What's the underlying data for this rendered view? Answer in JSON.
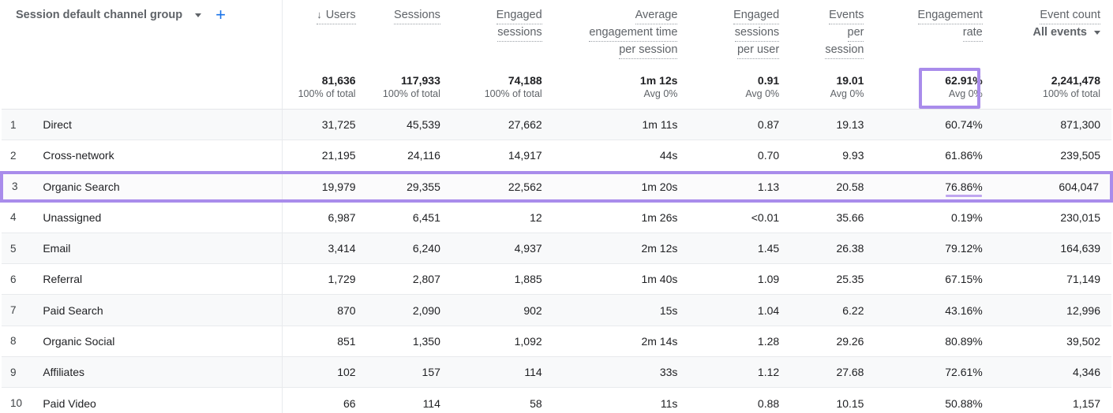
{
  "header": {
    "dimension_label": "Session default channel group",
    "dimension_caret_icon": "chevron-down-icon",
    "add_dimension_icon": "plus-icon",
    "sort_icon": "arrow-down-icon",
    "accent_purple": "#a98ceb",
    "accent_blue": "#1a73e8",
    "columns": [
      {
        "id": "users",
        "label": "Users",
        "label2": "",
        "sorted": true
      },
      {
        "id": "sessions",
        "label": "Sessions",
        "label2": "",
        "sorted": false
      },
      {
        "id": "engaged_sessions",
        "label": "Engaged",
        "label2": "sessions",
        "sorted": false
      },
      {
        "id": "avg_engagement_time",
        "label": "Average",
        "label2": "engagement time",
        "label3": "per session",
        "sorted": false
      },
      {
        "id": "engaged_sessions_per_user",
        "label": "Engaged",
        "label2": "sessions",
        "label3": "per user",
        "sorted": false
      },
      {
        "id": "events_per_session",
        "label": "Events",
        "label2": "per",
        "label3": "session",
        "sorted": false
      },
      {
        "id": "engagement_rate",
        "label": "Engagement",
        "label2": "rate",
        "sorted": false
      },
      {
        "id": "event_count",
        "label": "Event count",
        "label2": "",
        "dropdown": "All events",
        "dropdown_caret_icon": "chevron-down-icon",
        "sorted": false
      }
    ]
  },
  "totals": {
    "users": {
      "value": "81,636",
      "sub": "100% of total"
    },
    "sessions": {
      "value": "117,933",
      "sub": "100% of total"
    },
    "engaged_sessions": {
      "value": "74,188",
      "sub": "100% of total"
    },
    "avg_engagement_time": {
      "value": "1m 12s",
      "sub": "Avg 0%"
    },
    "engaged_sessions_per_user": {
      "value": "0.91",
      "sub": "Avg 0%"
    },
    "events_per_session": {
      "value": "19.01",
      "sub": "Avg 0%"
    },
    "engagement_rate": {
      "value": "62.91%",
      "sub": "Avg 0%",
      "highlighted": true
    },
    "event_count": {
      "value": "2,241,478",
      "sub": "100% of total"
    }
  },
  "rows": [
    {
      "rank": "1",
      "channel": "Direct",
      "users": "31,725",
      "sessions": "45,539",
      "engaged_sessions": "27,662",
      "avg_engagement_time": "1m 11s",
      "engaged_sessions_per_user": "0.87",
      "events_per_session": "19.13",
      "engagement_rate": "60.74%",
      "event_count": "871,300"
    },
    {
      "rank": "2",
      "channel": "Cross-network",
      "users": "21,195",
      "sessions": "24,116",
      "engaged_sessions": "14,917",
      "avg_engagement_time": "44s",
      "engaged_sessions_per_user": "0.70",
      "events_per_session": "9.93",
      "engagement_rate": "61.86%",
      "event_count": "239,505"
    },
    {
      "rank": "3",
      "channel": "Organic Search",
      "users": "19,979",
      "sessions": "29,355",
      "engaged_sessions": "22,562",
      "avg_engagement_time": "1m 20s",
      "engaged_sessions_per_user": "1.13",
      "events_per_session": "20.58",
      "engagement_rate": "76.86%",
      "event_count": "604,047"
    },
    {
      "rank": "4",
      "channel": "Unassigned",
      "users": "6,987",
      "sessions": "6,451",
      "engaged_sessions": "12",
      "avg_engagement_time": "1m 26s",
      "engaged_sessions_per_user": "<0.01",
      "events_per_session": "35.66",
      "engagement_rate": "0.19%",
      "event_count": "230,015"
    },
    {
      "rank": "5",
      "channel": "Email",
      "users": "3,414",
      "sessions": "6,240",
      "engaged_sessions": "4,937",
      "avg_engagement_time": "2m 12s",
      "engaged_sessions_per_user": "1.45",
      "events_per_session": "26.38",
      "engagement_rate": "79.12%",
      "event_count": "164,639"
    },
    {
      "rank": "6",
      "channel": "Referral",
      "users": "1,729",
      "sessions": "2,807",
      "engaged_sessions": "1,885",
      "avg_engagement_time": "1m 40s",
      "engaged_sessions_per_user": "1.09",
      "events_per_session": "25.35",
      "engagement_rate": "67.15%",
      "event_count": "71,149"
    },
    {
      "rank": "7",
      "channel": "Paid Search",
      "users": "870",
      "sessions": "2,090",
      "engaged_sessions": "902",
      "avg_engagement_time": "15s",
      "engaged_sessions_per_user": "1.04",
      "events_per_session": "6.22",
      "engagement_rate": "43.16%",
      "event_count": "12,996"
    },
    {
      "rank": "8",
      "channel": "Organic Social",
      "users": "851",
      "sessions": "1,350",
      "engaged_sessions": "1,092",
      "avg_engagement_time": "2m 14s",
      "engaged_sessions_per_user": "1.28",
      "events_per_session": "29.26",
      "engagement_rate": "80.89%",
      "event_count": "39,502"
    },
    {
      "rank": "9",
      "channel": "Affiliates",
      "users": "102",
      "sessions": "157",
      "engaged_sessions": "114",
      "avg_engagement_time": "33s",
      "engaged_sessions_per_user": "1.12",
      "events_per_session": "27.68",
      "engagement_rate": "72.61%",
      "event_count": "4,346"
    },
    {
      "rank": "10",
      "channel": "Paid Video",
      "users": "66",
      "sessions": "114",
      "engaged_sessions": "58",
      "avg_engagement_time": "11s",
      "engaged_sessions_per_user": "0.88",
      "events_per_session": "10.15",
      "engagement_rate": "50.88%",
      "event_count": "1,157"
    }
  ],
  "chart_data": {
    "type": "table",
    "title": "",
    "dimension": "Session default channel group",
    "columns": [
      "Users",
      "Sessions",
      "Engaged sessions",
      "Average engagement time per session",
      "Engaged sessions per user",
      "Events per session",
      "Engagement rate",
      "Event count"
    ],
    "categories": [
      "Direct",
      "Cross-network",
      "Organic Search",
      "Unassigned",
      "Email",
      "Referral",
      "Paid Search",
      "Organic Social",
      "Affiliates",
      "Paid Video"
    ],
    "series": [
      {
        "name": "Users",
        "values": [
          31725,
          21195,
          19979,
          6987,
          3414,
          1729,
          870,
          851,
          102,
          66
        ],
        "total": 81636
      },
      {
        "name": "Sessions",
        "values": [
          45539,
          24116,
          29355,
          6451,
          6240,
          2807,
          2090,
          1350,
          157,
          114
        ],
        "total": 117933
      },
      {
        "name": "Engaged sessions",
        "values": [
          27662,
          14917,
          22562,
          12,
          4937,
          1885,
          902,
          1092,
          114,
          58
        ],
        "total": 74188
      },
      {
        "name": "Average engagement time per session (s)",
        "values": [
          71,
          44,
          80,
          86,
          132,
          100,
          15,
          134,
          33,
          11
        ],
        "total": 72
      },
      {
        "name": "Engaged sessions per user",
        "values": [
          0.87,
          0.7,
          1.13,
          0.01,
          1.45,
          1.09,
          1.04,
          1.28,
          1.12,
          0.88
        ],
        "total": 0.91
      },
      {
        "name": "Events per session",
        "values": [
          19.13,
          9.93,
          20.58,
          35.66,
          26.38,
          25.35,
          6.22,
          29.26,
          27.68,
          10.15
        ],
        "total": 19.01
      },
      {
        "name": "Engagement rate (%)",
        "values": [
          60.74,
          61.86,
          76.86,
          0.19,
          79.12,
          67.15,
          43.16,
          80.89,
          72.61,
          50.88
        ],
        "total": 62.91
      },
      {
        "name": "Event count",
        "values": [
          871300,
          239505,
          604047,
          230015,
          164639,
          71149,
          12996,
          39502,
          4346,
          1157
        ],
        "total": 2241478
      }
    ],
    "highlights": [
      {
        "type": "cell",
        "row": "totals",
        "column": "Engagement rate",
        "value": "62.91%"
      },
      {
        "type": "row",
        "row": "Organic Search"
      },
      {
        "type": "underline",
        "row": "Organic Search",
        "column": "Engagement rate",
        "value": "76.86%"
      }
    ]
  }
}
